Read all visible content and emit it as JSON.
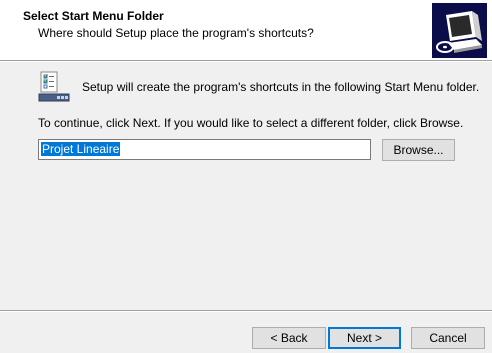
{
  "header": {
    "title": "Select Start Menu Folder",
    "subtitle": "Where should Setup place the program's shortcuts?",
    "logo_icon": "computer-setup-icon"
  },
  "main": {
    "info_icon": "start-menu-folder-icon",
    "info_text": "Setup will create the program's shortcuts in the following Start Menu folder.",
    "continue_text": "To continue, click Next. If you would like to select a different folder, click Browse.",
    "folder_value": "Projet Lineaire",
    "browse_label": "Browse..."
  },
  "footer": {
    "back_label": "< Back",
    "next_label": "Next >",
    "cancel_label": "Cancel"
  },
  "colors": {
    "logo_background": "#0b0d4a",
    "selection": "#0078d7",
    "default_button_border": "#0078d7"
  }
}
